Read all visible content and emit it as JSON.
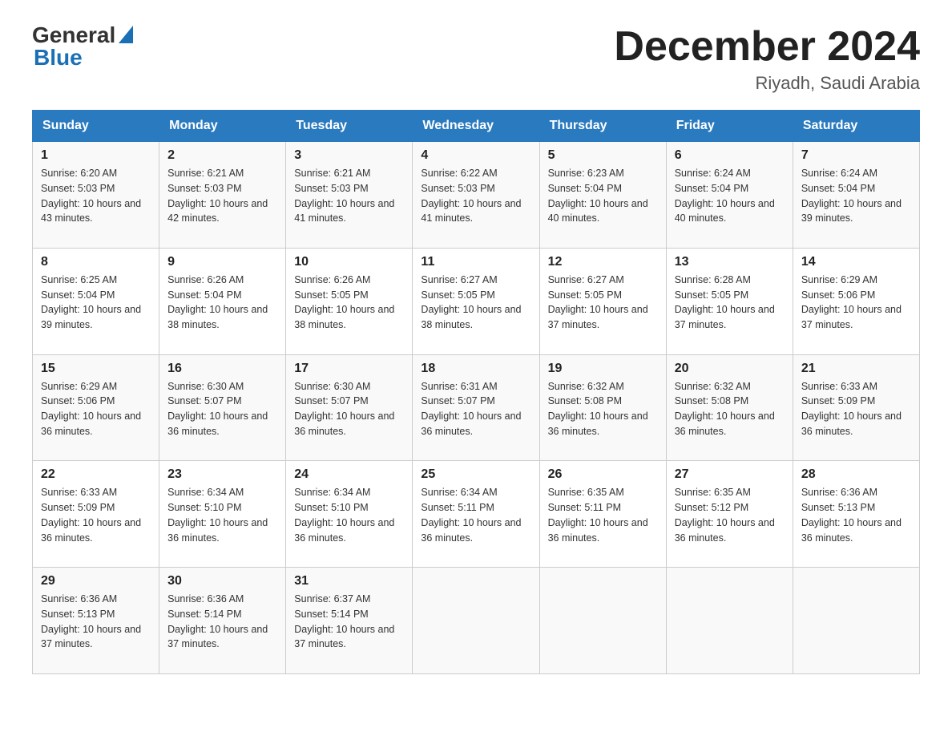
{
  "header": {
    "logo_general": "General",
    "logo_blue": "Blue",
    "month_title": "December 2024",
    "location": "Riyadh, Saudi Arabia"
  },
  "days_of_week": [
    "Sunday",
    "Monday",
    "Tuesday",
    "Wednesday",
    "Thursday",
    "Friday",
    "Saturday"
  ],
  "weeks": [
    [
      {
        "day": "1",
        "sunrise": "6:20 AM",
        "sunset": "5:03 PM",
        "daylight": "10 hours and 43 minutes."
      },
      {
        "day": "2",
        "sunrise": "6:21 AM",
        "sunset": "5:03 PM",
        "daylight": "10 hours and 42 minutes."
      },
      {
        "day": "3",
        "sunrise": "6:21 AM",
        "sunset": "5:03 PM",
        "daylight": "10 hours and 41 minutes."
      },
      {
        "day": "4",
        "sunrise": "6:22 AM",
        "sunset": "5:03 PM",
        "daylight": "10 hours and 41 minutes."
      },
      {
        "day": "5",
        "sunrise": "6:23 AM",
        "sunset": "5:04 PM",
        "daylight": "10 hours and 40 minutes."
      },
      {
        "day": "6",
        "sunrise": "6:24 AM",
        "sunset": "5:04 PM",
        "daylight": "10 hours and 40 minutes."
      },
      {
        "day": "7",
        "sunrise": "6:24 AM",
        "sunset": "5:04 PM",
        "daylight": "10 hours and 39 minutes."
      }
    ],
    [
      {
        "day": "8",
        "sunrise": "6:25 AM",
        "sunset": "5:04 PM",
        "daylight": "10 hours and 39 minutes."
      },
      {
        "day": "9",
        "sunrise": "6:26 AM",
        "sunset": "5:04 PM",
        "daylight": "10 hours and 38 minutes."
      },
      {
        "day": "10",
        "sunrise": "6:26 AM",
        "sunset": "5:05 PM",
        "daylight": "10 hours and 38 minutes."
      },
      {
        "day": "11",
        "sunrise": "6:27 AM",
        "sunset": "5:05 PM",
        "daylight": "10 hours and 38 minutes."
      },
      {
        "day": "12",
        "sunrise": "6:27 AM",
        "sunset": "5:05 PM",
        "daylight": "10 hours and 37 minutes."
      },
      {
        "day": "13",
        "sunrise": "6:28 AM",
        "sunset": "5:05 PM",
        "daylight": "10 hours and 37 minutes."
      },
      {
        "day": "14",
        "sunrise": "6:29 AM",
        "sunset": "5:06 PM",
        "daylight": "10 hours and 37 minutes."
      }
    ],
    [
      {
        "day": "15",
        "sunrise": "6:29 AM",
        "sunset": "5:06 PM",
        "daylight": "10 hours and 36 minutes."
      },
      {
        "day": "16",
        "sunrise": "6:30 AM",
        "sunset": "5:07 PM",
        "daylight": "10 hours and 36 minutes."
      },
      {
        "day": "17",
        "sunrise": "6:30 AM",
        "sunset": "5:07 PM",
        "daylight": "10 hours and 36 minutes."
      },
      {
        "day": "18",
        "sunrise": "6:31 AM",
        "sunset": "5:07 PM",
        "daylight": "10 hours and 36 minutes."
      },
      {
        "day": "19",
        "sunrise": "6:32 AM",
        "sunset": "5:08 PM",
        "daylight": "10 hours and 36 minutes."
      },
      {
        "day": "20",
        "sunrise": "6:32 AM",
        "sunset": "5:08 PM",
        "daylight": "10 hours and 36 minutes."
      },
      {
        "day": "21",
        "sunrise": "6:33 AM",
        "sunset": "5:09 PM",
        "daylight": "10 hours and 36 minutes."
      }
    ],
    [
      {
        "day": "22",
        "sunrise": "6:33 AM",
        "sunset": "5:09 PM",
        "daylight": "10 hours and 36 minutes."
      },
      {
        "day": "23",
        "sunrise": "6:34 AM",
        "sunset": "5:10 PM",
        "daylight": "10 hours and 36 minutes."
      },
      {
        "day": "24",
        "sunrise": "6:34 AM",
        "sunset": "5:10 PM",
        "daylight": "10 hours and 36 minutes."
      },
      {
        "day": "25",
        "sunrise": "6:34 AM",
        "sunset": "5:11 PM",
        "daylight": "10 hours and 36 minutes."
      },
      {
        "day": "26",
        "sunrise": "6:35 AM",
        "sunset": "5:11 PM",
        "daylight": "10 hours and 36 minutes."
      },
      {
        "day": "27",
        "sunrise": "6:35 AM",
        "sunset": "5:12 PM",
        "daylight": "10 hours and 36 minutes."
      },
      {
        "day": "28",
        "sunrise": "6:36 AM",
        "sunset": "5:13 PM",
        "daylight": "10 hours and 36 minutes."
      }
    ],
    [
      {
        "day": "29",
        "sunrise": "6:36 AM",
        "sunset": "5:13 PM",
        "daylight": "10 hours and 37 minutes."
      },
      {
        "day": "30",
        "sunrise": "6:36 AM",
        "sunset": "5:14 PM",
        "daylight": "10 hours and 37 minutes."
      },
      {
        "day": "31",
        "sunrise": "6:37 AM",
        "sunset": "5:14 PM",
        "daylight": "10 hours and 37 minutes."
      },
      null,
      null,
      null,
      null
    ]
  ],
  "labels": {
    "sunrise": "Sunrise:",
    "sunset": "Sunset:",
    "daylight": "Daylight:"
  }
}
